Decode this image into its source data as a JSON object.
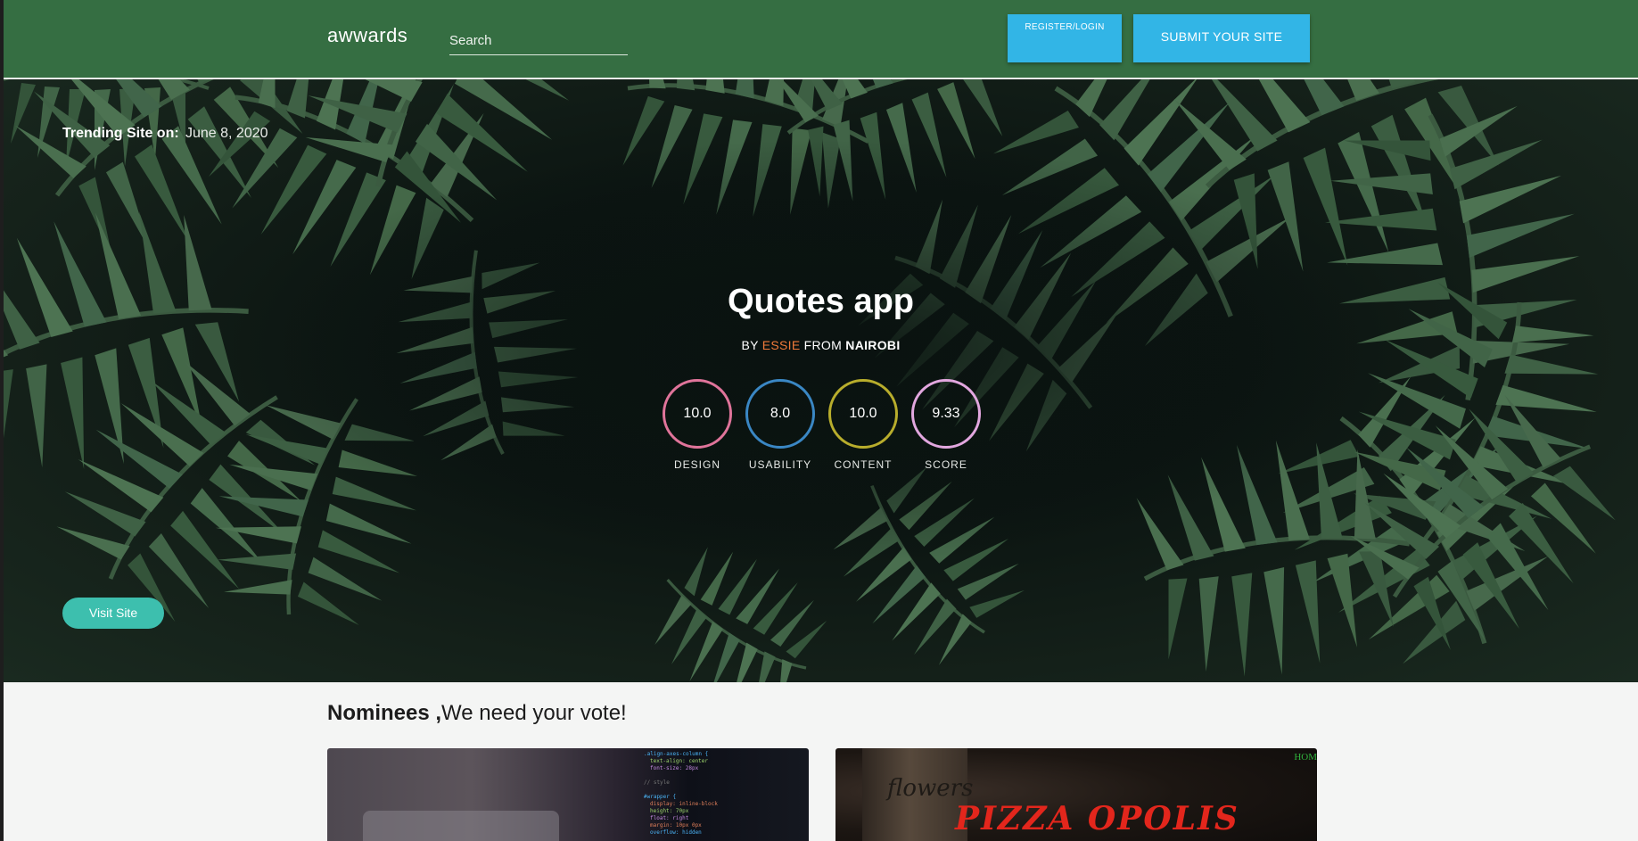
{
  "navbar": {
    "brand": "awwards",
    "search_placeholder": "Search",
    "register_label": "REGISTER/LOGIN",
    "submit_label": "SUBMIT YOUR SITE"
  },
  "hero": {
    "trending_label": "Trending Site on:",
    "trending_date": "June 8, 2020",
    "title": "Quotes app",
    "by_prefix": "BY",
    "author": "ESSIE",
    "from_word": "FROM",
    "city": "NAIROBI",
    "scores": [
      {
        "value": "10.0",
        "label": "DESIGN",
        "color": "#e0749a"
      },
      {
        "value": "8.0",
        "label": "USABILITY",
        "color": "#3a87c4"
      },
      {
        "value": "10.0",
        "label": "CONTENT",
        "color": "#b8ad2c"
      },
      {
        "value": "9.33",
        "label": "SCORE",
        "color": "#e2a7df"
      }
    ],
    "visit_label": "Visit Site"
  },
  "nominees": {
    "heading_strong": "Nominees ,",
    "heading_rest": "We need your vote!",
    "cards": [
      {
        "type": "code-screenshot"
      },
      {
        "title": "PIZZA OPOLIS",
        "nav_text": "HOM",
        "bottle_text": "flowers"
      }
    ]
  },
  "colors": {
    "navbar": "#356e42",
    "button": "#32b5e6",
    "visit_button": "#3dbfae",
    "author": "#f07a3a"
  }
}
